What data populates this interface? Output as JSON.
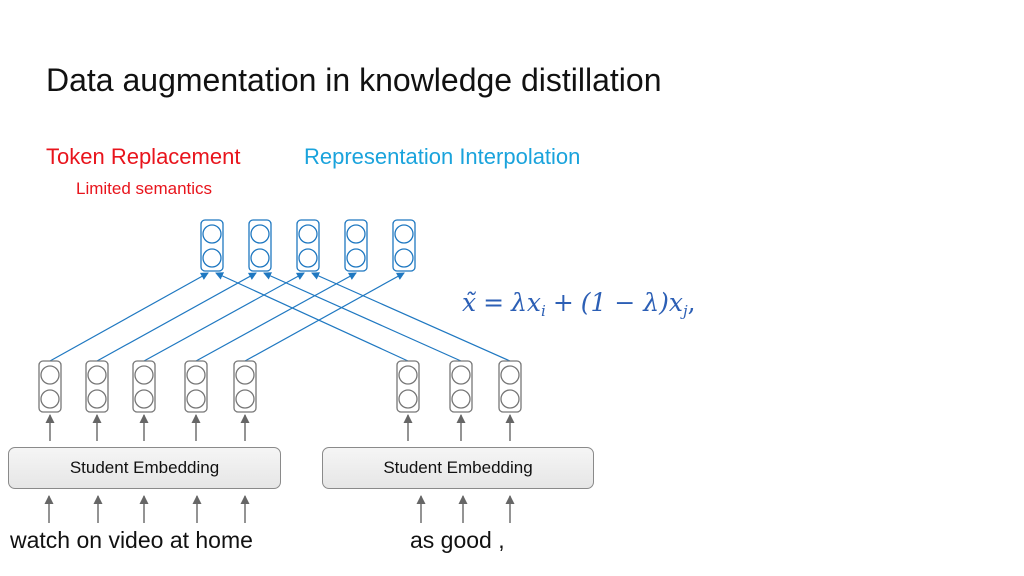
{
  "slide": {
    "title": "Data augmentation in knowledge distillation",
    "methods": {
      "token_replacement": "Token Replacement",
      "token_replacement_note": "Limited semantics",
      "representation_interpolation": "Representation Interpolation"
    },
    "colors": {
      "token_replacement": "#e8141c",
      "representation_interpolation": "#1aa3dc",
      "interpolation_lines": "#1f78c1",
      "formula": "#2c5fb5",
      "student_nodes": "#777777"
    }
  },
  "formula": {
    "lhs": "x̃",
    "eq": "=",
    "term1": "λx",
    "sub1": "i",
    "plus": "+",
    "term2": "(1 − λ)x",
    "sub2": "j",
    "tail": ","
  },
  "diagram": {
    "mixed_representations": 5,
    "sentence_a": {
      "embedding_label": "Student Embedding",
      "text": "watch on video at home",
      "tokens": [
        "watch",
        "on",
        "video",
        "at",
        "home"
      ]
    },
    "sentence_b": {
      "embedding_label": "Student Embedding",
      "text": "as good ,",
      "tokens": [
        "as",
        "good",
        ","
      ]
    },
    "connections_a_to_mixed": [
      0,
      1,
      2,
      3,
      4
    ],
    "connections_b_to_mixed": [
      0,
      1,
      2
    ]
  }
}
